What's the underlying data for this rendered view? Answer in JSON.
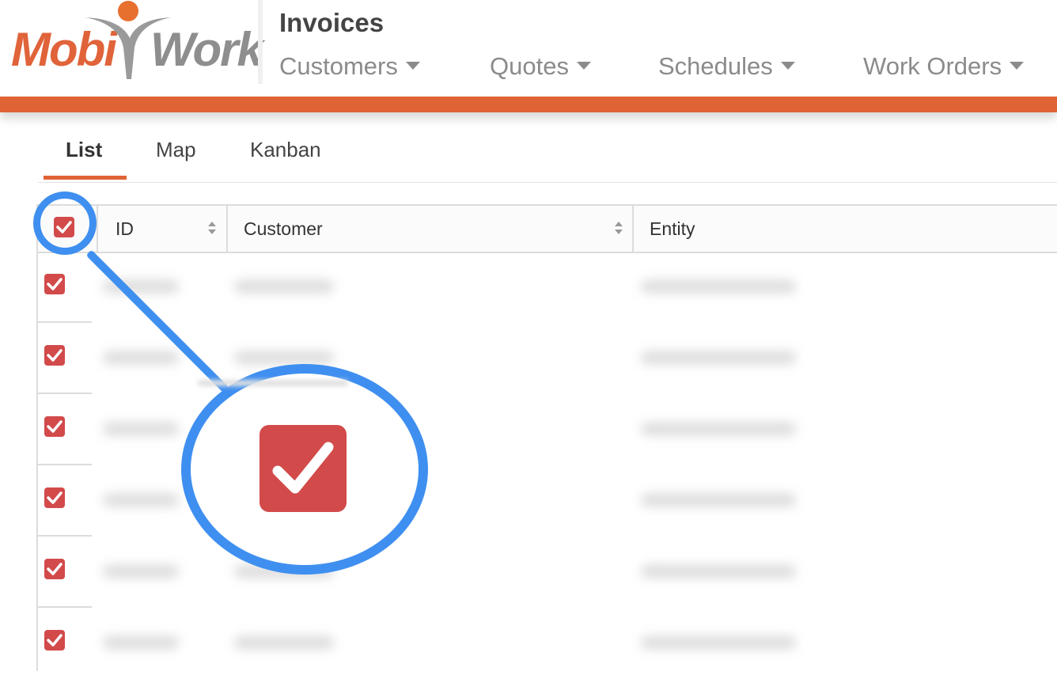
{
  "app": {
    "logo_mobi": "Mobi",
    "logo_work": "Work",
    "page_title": "Invoices"
  },
  "nav": {
    "items": [
      {
        "label": "Customers"
      },
      {
        "label": "Quotes"
      },
      {
        "label": "Schedules"
      },
      {
        "label": "Work Orders"
      }
    ]
  },
  "tabs": {
    "items": [
      {
        "label": "List",
        "active": true
      },
      {
        "label": "Map",
        "active": false
      },
      {
        "label": "Kanban",
        "active": false
      }
    ]
  },
  "table": {
    "columns": [
      {
        "label": "ID",
        "sortable": true
      },
      {
        "label": "Customer",
        "sortable": true
      },
      {
        "label": "Entity",
        "sortable": false
      }
    ],
    "rows_checked": [
      true,
      true,
      true,
      true,
      true,
      true
    ],
    "select_all_checked": true
  },
  "colors": {
    "brand_orange": "#e06335",
    "checkbox_red": "#d24a4a",
    "callout_blue": "#3f8ff0"
  },
  "icons": {
    "checkbox": "checkmark-icon",
    "sort": "sort-icon",
    "dropdown": "caret-down-icon"
  }
}
